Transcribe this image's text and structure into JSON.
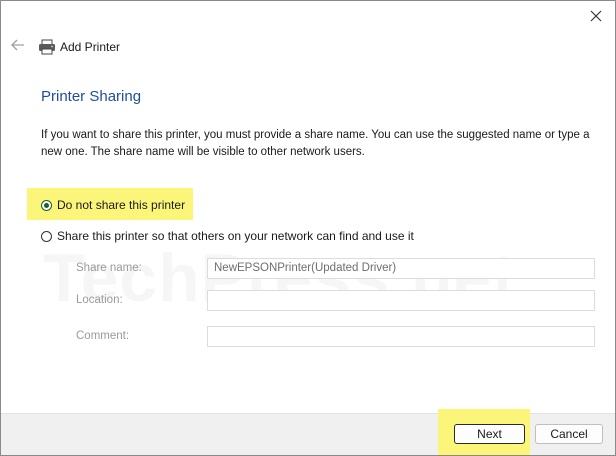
{
  "window": {
    "title": "Add Printer",
    "close_icon": "close-icon",
    "back_icon": "back-arrow-icon",
    "title_icon": "printer-icon"
  },
  "content": {
    "heading": "Printer Sharing",
    "intro": "If you want to share this printer, you must provide a share name. You can use the suggested name or type a new one. The share name will be visible to other network users.",
    "options": [
      {
        "label": "Do not share this printer",
        "selected": true
      },
      {
        "label": "Share this printer so that others on your network can find and use it",
        "selected": false
      }
    ],
    "fields": {
      "share_name": {
        "label": "Share name:",
        "value": "NewEPSONPrinter(Updated Driver)"
      },
      "location": {
        "label": "Location:",
        "value": ""
      },
      "comment": {
        "label": "Comment:",
        "value": ""
      }
    }
  },
  "watermark": "TechPress.net",
  "buttons": {
    "next": "Next",
    "cancel": "Cancel"
  },
  "colors": {
    "heading": "#1f4e9c",
    "highlight": "#fbf57a",
    "radio_selected": "#1f5e2a",
    "footer": "#f0f0f0"
  }
}
